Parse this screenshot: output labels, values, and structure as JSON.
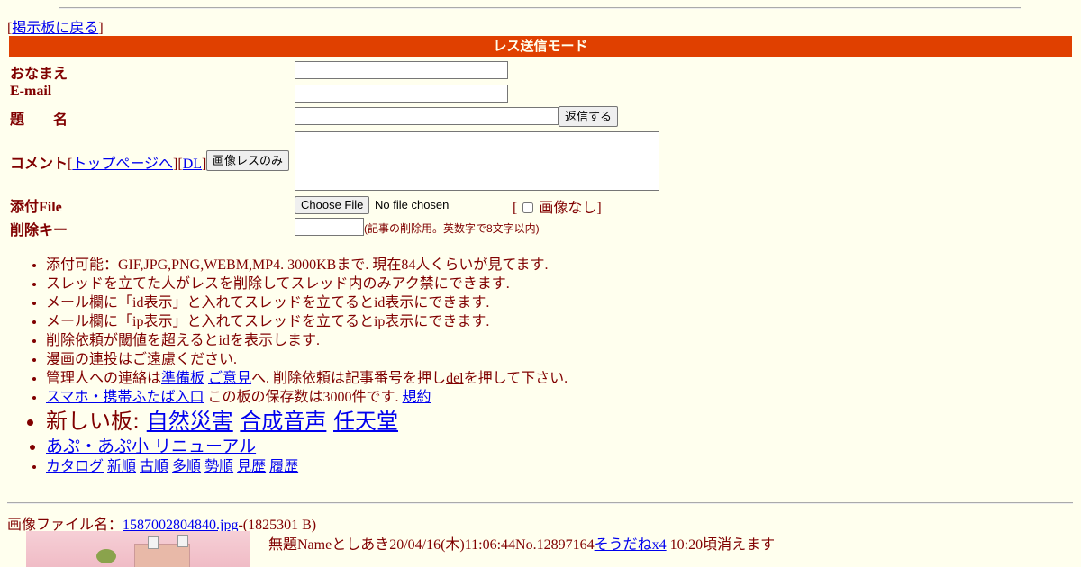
{
  "nav": {
    "bracket_open": "[",
    "back_link": "掲示板に戻る",
    "bracket_close": "]"
  },
  "mode_title": "レス送信モード",
  "form": {
    "name_label": "おなまえ",
    "email_label": "E-mail",
    "subject_label": "題　　名",
    "submit_label": "返信する",
    "comment_label": "コメント",
    "top_link": "トップページへ",
    "dl_link": "DL",
    "image_only_label": "画像レスのみ",
    "file_label": "添付File",
    "choose_file_label": "Choose File",
    "no_file_text": "No file chosen",
    "no_image_open": "[",
    "no_image_label": "画像なし]",
    "delete_key_label": "削除キー",
    "delete_key_note": "(記事の削除用。英数字で8文字以内)"
  },
  "notes": {
    "n1": "添付可能：GIF,JPG,PNG,WEBM,MP4. 3000KBまで. 現在84人くらいが見てます.",
    "n2": "スレッドを立てた人がレスを削除してスレッド内のみアク禁にできます.",
    "n3": "メール欄に「id表示」と入れてスレッドを立てるとid表示にできます.",
    "n4": "メール欄に「ip表示」と入れてスレッドを立てるとip表示にできます.",
    "n5": "削除依頼が閾値を超えるとidを表示します.",
    "n6": "漫画の連投はご遠慮ください.",
    "n7_pre": "管理人への連絡は",
    "n7_link1": "準備板",
    "n7_link2": "ご意見",
    "n7_mid": "へ. 削除依頼は記事番号を押し",
    "n7_del": "del",
    "n7_post": "を押して下さい.",
    "n8_link": "スマホ・携帯ふたば入口",
    "n8_text": "この板の保存数は3000件です.",
    "n8_rules": "規約",
    "n9_text": "新しい板:",
    "n9_link1": "自然災害",
    "n9_link2": "合成音声",
    "n9_link3": "任天堂",
    "n10_link": "あぷ・あぷ小 リニューアル",
    "catalog": [
      "カタログ",
      "新順",
      "古順",
      "多順",
      "勢順",
      "見歴",
      "履歴"
    ]
  },
  "post": {
    "file_prefix": "画像ファイル名：",
    "file_name": "1587002804840.jpg",
    "file_size": "-(1825301 B)",
    "header_text": "無題Nameとしあき20/04/16(木)11:06:44No.12897164",
    "sodane": "そうだねx4",
    "expire": "10:20頃消えます"
  },
  "colors": {
    "background": "#ffffee",
    "text": "#800000",
    "mode_bar": "#e04000",
    "link": "#0000ee"
  }
}
